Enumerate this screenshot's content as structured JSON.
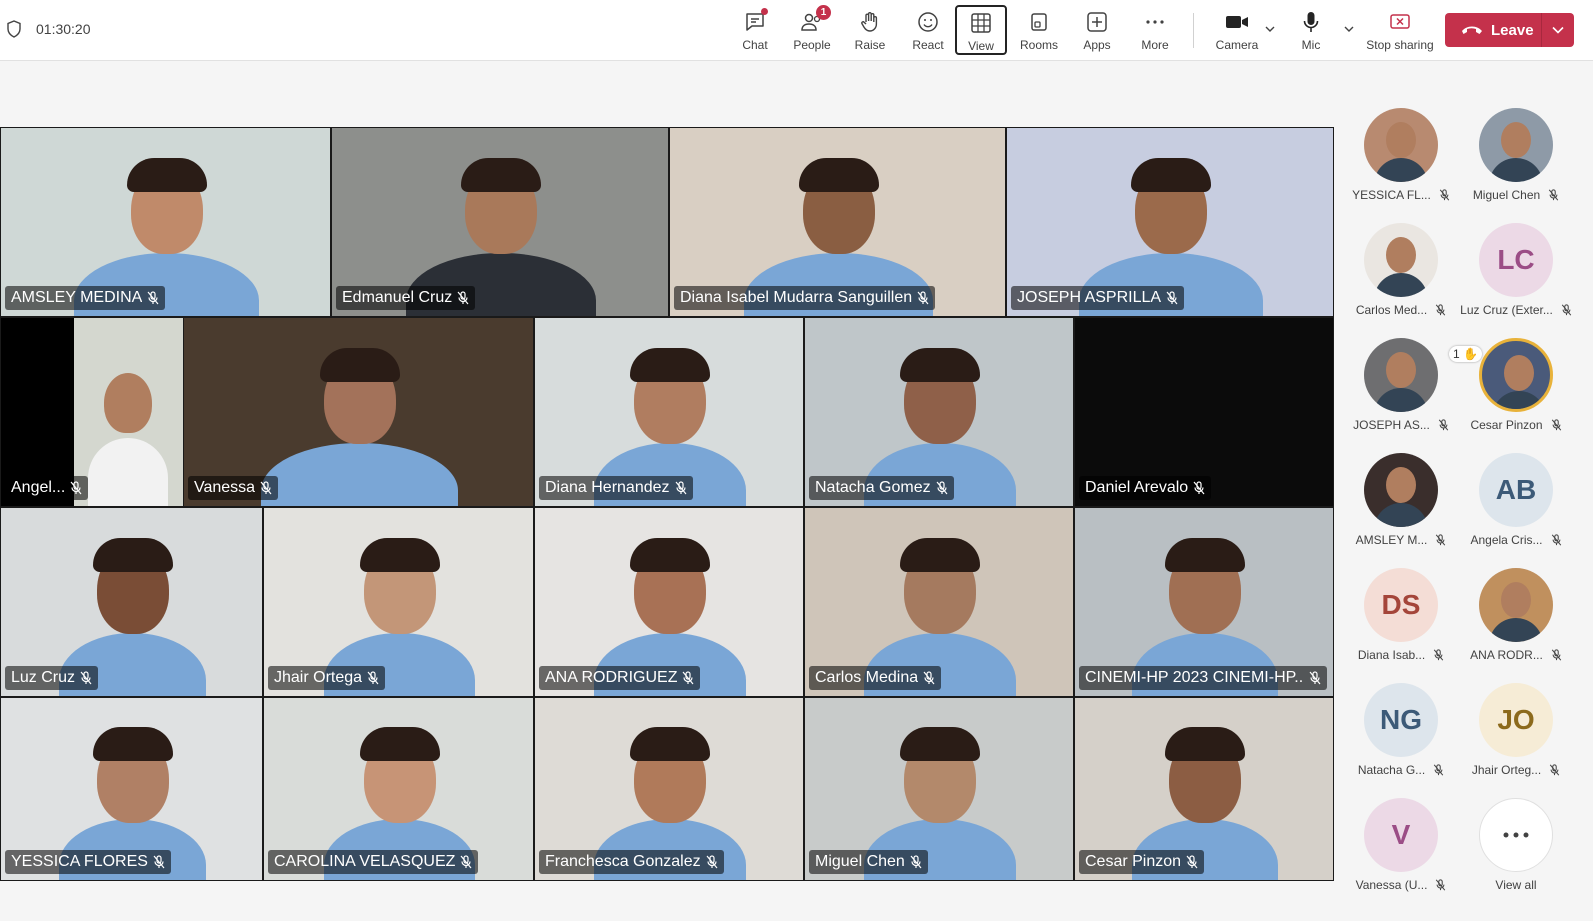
{
  "meeting": {
    "timer": "01:30:20"
  },
  "toolbar": {
    "chat": "Chat",
    "people": "People",
    "people_badge": "1",
    "raise": "Raise",
    "react": "React",
    "view": "View",
    "rooms": "Rooms",
    "apps": "Apps",
    "more": "More",
    "camera": "Camera",
    "mic": "Mic",
    "stop_sharing": "Stop sharing",
    "leave": "Leave"
  },
  "tiles": [
    {
      "name": "AMSLEY MEDINA",
      "bg": "#cfd8d6",
      "skin": "#c08a6a"
    },
    {
      "name": "Edmanuel Cruz",
      "bg": "#8d8f8c",
      "skin": "#a9795a"
    },
    {
      "name": "Diana Isabel Mudarra Sanguillen",
      "bg": "#d9cfc3",
      "skin": "#8a5e42"
    },
    {
      "name": "JOSEPH ASPRILLA",
      "bg": "#c7cde0",
      "skin": "#9b6a4b"
    },
    {
      "name": "Angel...",
      "bg": "#d4d7cf",
      "skin": "#b07e5f"
    },
    {
      "name": "Vanessa",
      "bg": "#4a3b2e",
      "skin": "#a3725a"
    },
    {
      "name": "Diana Hernandez",
      "bg": "#d7dcdc",
      "skin": "#b07d60"
    },
    {
      "name": "Natacha Gomez",
      "bg": "#bfc6c9",
      "skin": "#8f6049"
    },
    {
      "name": "Daniel Arevalo",
      "bg": "#0b0b0b",
      "skin": ""
    },
    {
      "name": "Luz Cruz",
      "bg": "#d8dbdc",
      "skin": "#7a4d36"
    },
    {
      "name": "Jhair Ortega",
      "bg": "#e3e2de",
      "skin": "#c39678"
    },
    {
      "name": "ANA RODRIGUEZ",
      "bg": "#e6e4e2",
      "skin": "#a87155"
    },
    {
      "name": "Carlos Medina",
      "bg": "#cfc5b9",
      "skin": "#a57a5f"
    },
    {
      "name": "CINEMI-HP 2023 CINEMI-HP...",
      "bg": "#b9bfc3",
      "skin": "#a06f53"
    },
    {
      "name": "YESSICA FLORES",
      "bg": "#dfe1e2",
      "skin": "#b08065"
    },
    {
      "name": "CAROLINA VELASQUEZ",
      "bg": "#d9dcd9",
      "skin": "#c79476"
    },
    {
      "name": "Franchesca Gonzalez",
      "bg": "#dedbd6",
      "skin": "#b07a5a"
    },
    {
      "name": "Miguel Chen",
      "bg": "#c8cbca",
      "skin": "#b3896b"
    },
    {
      "name": "Cesar Pinzon",
      "bg": "#d5d0c9",
      "skin": "#8c5d43"
    }
  ],
  "roster": [
    {
      "name": "YESSICA FL...",
      "initials": "",
      "bg": "#b88a70"
    },
    {
      "name": "Miguel Chen",
      "initials": "",
      "bg": "#8e9aa7"
    },
    {
      "name": "Carlos Med...",
      "initials": "",
      "bg": "#eae6e1"
    },
    {
      "name": "Luz Cruz (Exter...",
      "initials": "LC",
      "bg": "#ecd9e6",
      "fg": "#9b4d86"
    },
    {
      "name": "JOSEPH AS...",
      "initials": "",
      "bg": "#6e6e70"
    },
    {
      "name": "Cesar Pinzon",
      "initials": "",
      "bg": "#4a5a7a",
      "hand": "1"
    },
    {
      "name": "AMSLEY M...",
      "initials": "",
      "bg": "#3a2e2c"
    },
    {
      "name": "Angela Cris...",
      "initials": "AB",
      "bg": "#dde5ec",
      "fg": "#3c5a78"
    },
    {
      "name": "Diana Isab...",
      "initials": "DS",
      "bg": "#f4ddd6",
      "fg": "#a4453a"
    },
    {
      "name": "ANA RODR...",
      "initials": "",
      "bg": "#c0905e"
    },
    {
      "name": "Natacha G...",
      "initials": "NG",
      "bg": "#dde5ec",
      "fg": "#3c5a78"
    },
    {
      "name": "Jhair Orteg...",
      "initials": "JO",
      "bg": "#f6ecd6",
      "fg": "#8c6a1c"
    },
    {
      "name": "Vanessa (U...",
      "initials": "V",
      "bg": "#ecd9e6",
      "fg": "#9b4d86"
    },
    {
      "name": "View all",
      "initials": "",
      "bg": "#ffffff",
      "more": true
    }
  ]
}
